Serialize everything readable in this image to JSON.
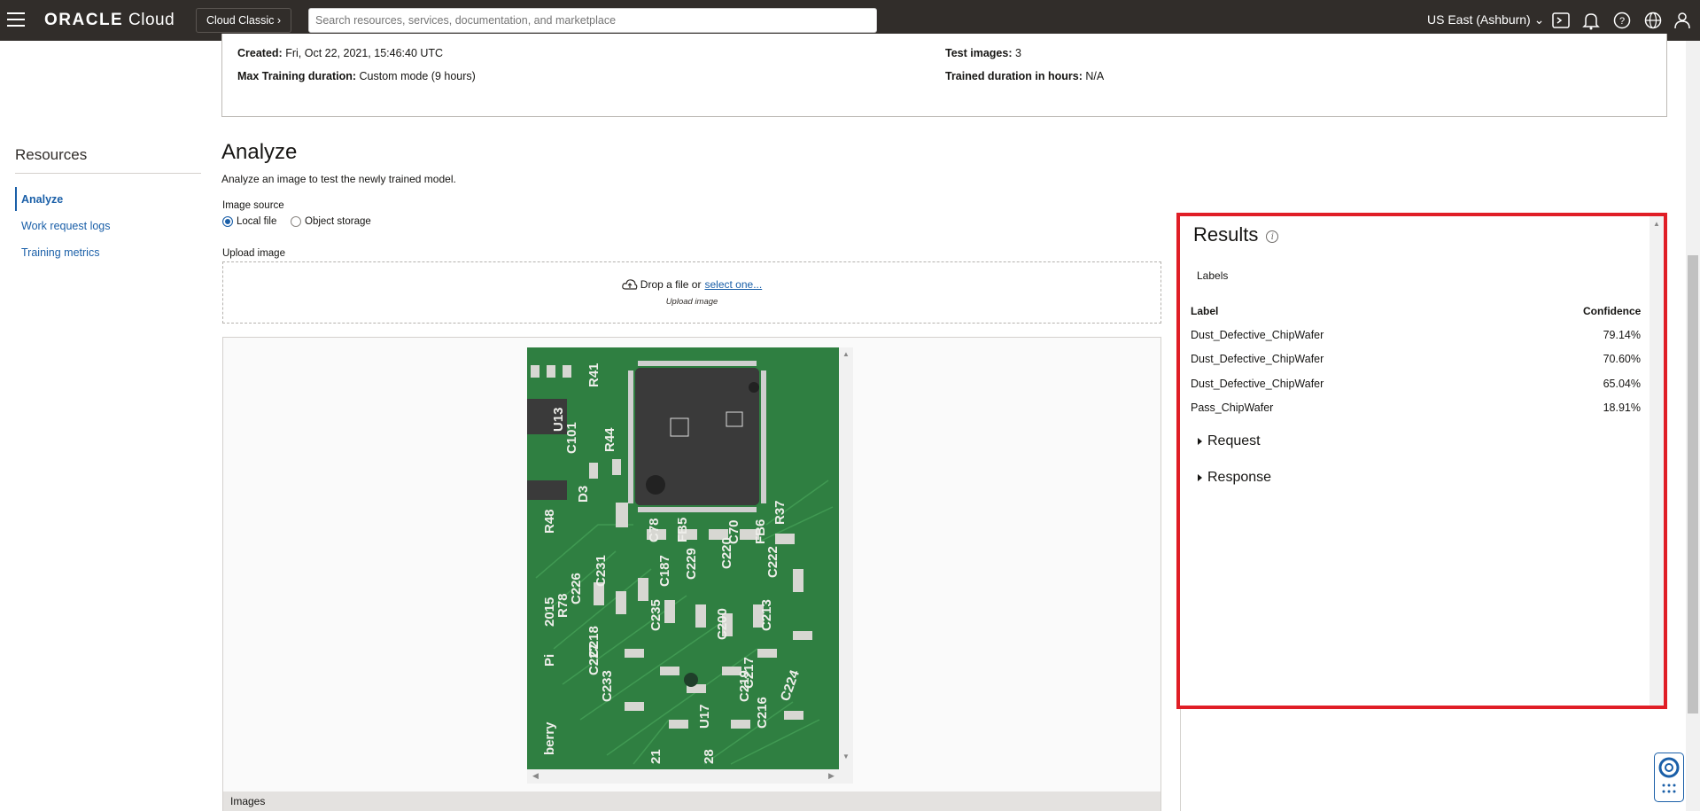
{
  "topbar": {
    "brand_bold": "ORACLE",
    "brand_rest": "Cloud",
    "classic_label": "Cloud Classic",
    "search_placeholder": "Search resources, services, documentation, and marketplace",
    "region": "US East (Ashburn)"
  },
  "details": {
    "created_label": "Created:",
    "created_value": "Fri, Oct 22, 2021, 15:46:40 UTC",
    "max_training_label": "Max Training duration:",
    "max_training_value": "Custom mode (9 hours)",
    "test_images_label": "Test images:",
    "test_images_value": "3",
    "trained_label": "Trained duration in hours:",
    "trained_value": "N/A"
  },
  "sidebar": {
    "title": "Resources",
    "items": [
      {
        "label": "Analyze",
        "active": true
      },
      {
        "label": "Work request logs"
      },
      {
        "label": "Training metrics"
      }
    ]
  },
  "analyze": {
    "title": "Analyze",
    "description": "Analyze an image to test the newly trained model.",
    "image_source_label": "Image source",
    "radio_local": "Local file",
    "radio_object": "Object storage",
    "upload_label": "Upload image",
    "drop_text": "Drop a file or",
    "select_link": "select one...",
    "drop_sub": "Upload image",
    "images_tab": "Images"
  },
  "pcb_labels": [
    "U13",
    "R41",
    "C101",
    "R44",
    "D3",
    "C78",
    "FB5",
    "C70",
    "FB6",
    "R48",
    "C231",
    "C187",
    "C229",
    "C220",
    "C222",
    "C226",
    "R78",
    "C235",
    "C200",
    "C213",
    "C227",
    "2015",
    "C218",
    "C233",
    "U17",
    "C219",
    "C217",
    "C216",
    "C224",
    "Pi",
    "berry",
    "R37",
    "21",
    "28"
  ],
  "results": {
    "title": "Results",
    "tab": "Labels",
    "col_label": "Label",
    "col_conf": "Confidence",
    "rows": [
      {
        "label": "Dust_Defective_ChipWafer",
        "confidence": "79.14%"
      },
      {
        "label": "Dust_Defective_ChipWafer",
        "confidence": "70.60%"
      },
      {
        "label": "Dust_Defective_ChipWafer",
        "confidence": "65.04%"
      },
      {
        "label": "Pass_ChipWafer",
        "confidence": "18.91%"
      }
    ],
    "request": "Request",
    "response": "Response"
  }
}
